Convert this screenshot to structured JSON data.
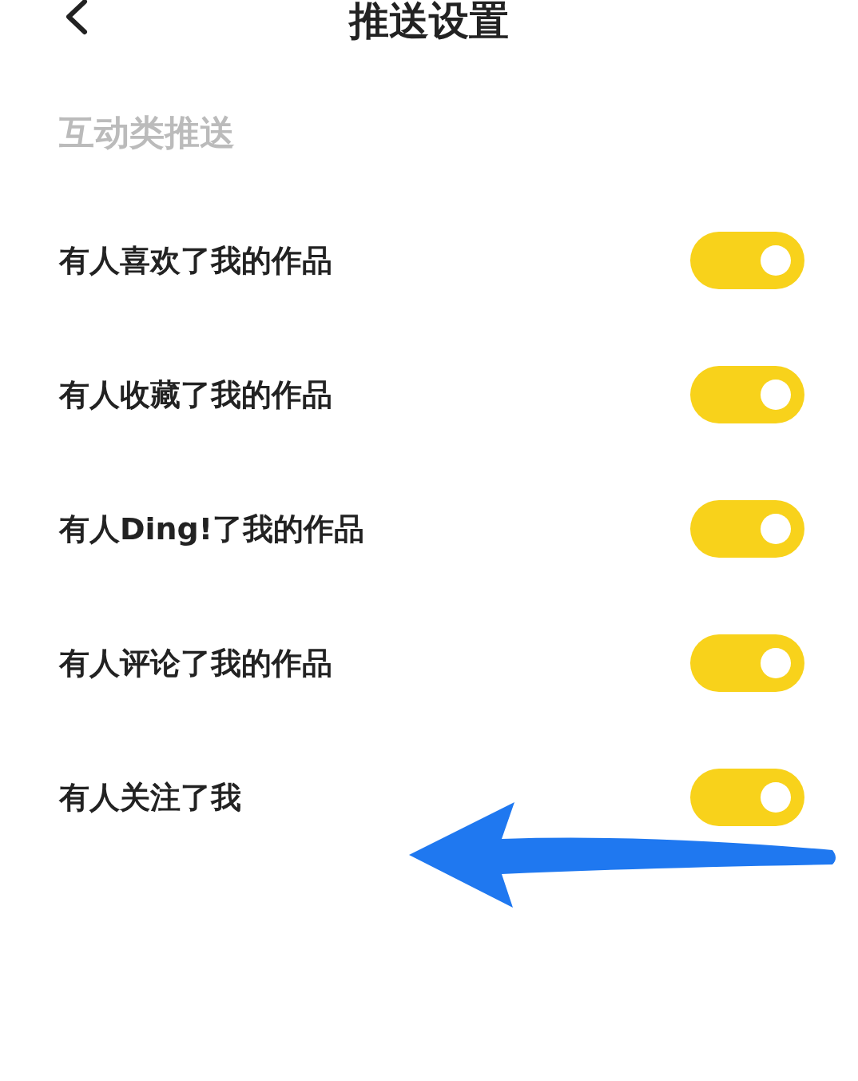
{
  "header": {
    "title": "推送设置"
  },
  "section": {
    "title": "互动类推送"
  },
  "items": [
    {
      "label": "有人喜欢了我的作品",
      "on": true
    },
    {
      "label": "有人收藏了我的作品",
      "on": true
    },
    {
      "label": "有人Ding!了我的作品",
      "on": true
    },
    {
      "label": "有人评论了我的作品",
      "on": true
    },
    {
      "label": "有人关注了我",
      "on": true
    }
  ]
}
